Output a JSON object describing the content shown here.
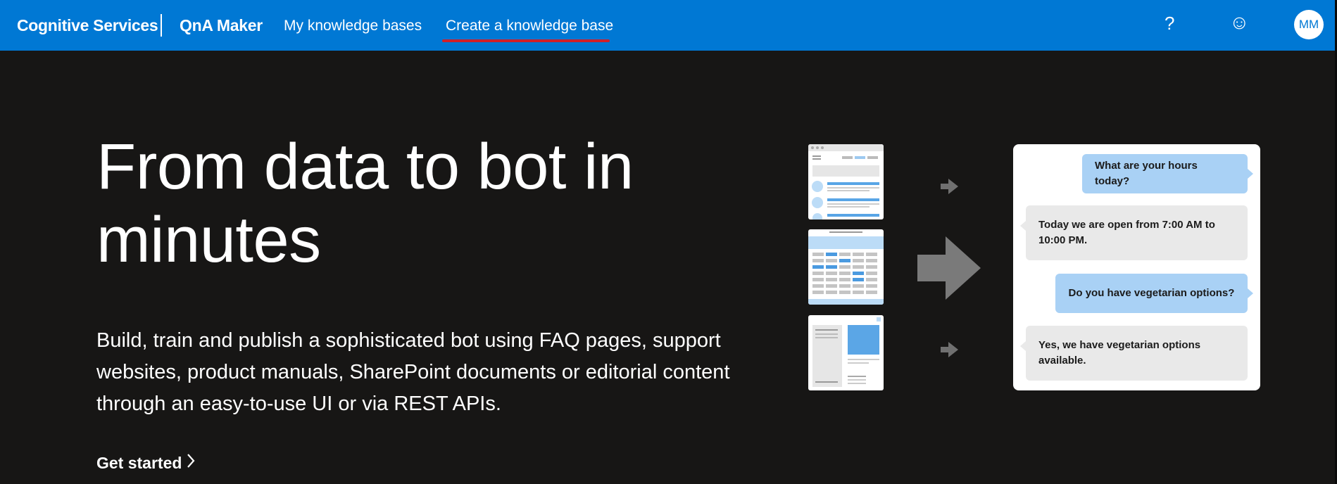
{
  "header": {
    "brand": "Cognitive Services",
    "product": "QnA Maker",
    "nav": [
      {
        "label": "My knowledge bases"
      },
      {
        "label": "Create a knowledge base",
        "active": true
      }
    ],
    "help_icon": "?",
    "feedback_icon": "☺",
    "avatar_initials": "MM",
    "colors": {
      "bar": "#0078d4",
      "active_underline": "#d0202a"
    }
  },
  "hero": {
    "title": "From data to bot in minutes",
    "description": "Build, train and publish a sophisticated bot using FAQ pages, support websites, product manuals, SharePoint documents or editorial content through an easy-to-use UI or via REST APIs.",
    "cta_label": "Get started",
    "cta_icon": "chevron-right-icon"
  },
  "illustration": {
    "sources": [
      "faq-page-thumbnail",
      "table-document-thumbnail",
      "product-manual-thumbnail"
    ],
    "chat": [
      {
        "from": "user",
        "text": "What are your hours today?"
      },
      {
        "from": "bot",
        "text": "Today we are open from 7:00 AM to 10:00 PM."
      },
      {
        "from": "user",
        "text": "Do you have vegetarian options?"
      },
      {
        "from": "bot",
        "text": "Yes, we have vegetarian options available."
      }
    ]
  }
}
